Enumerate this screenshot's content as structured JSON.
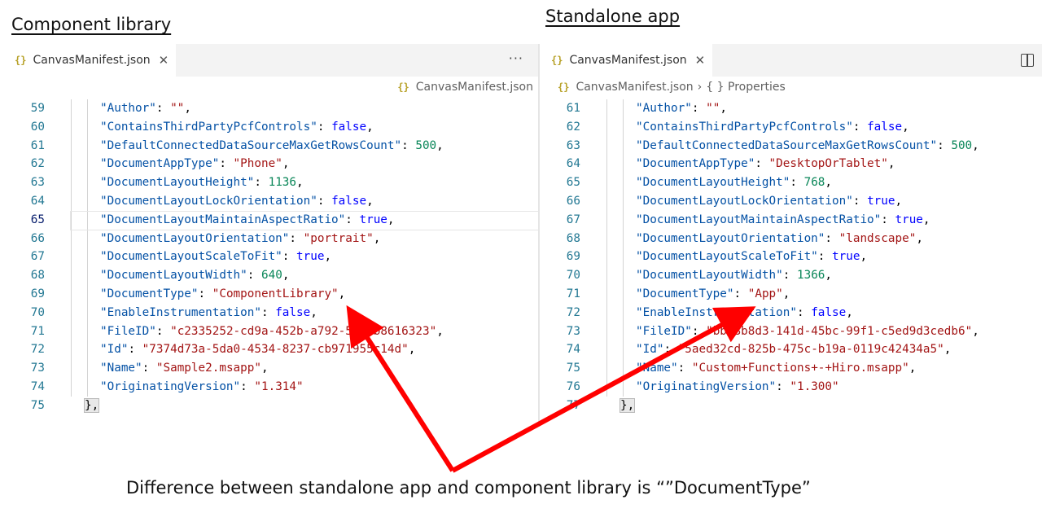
{
  "headings": {
    "left": "Component library",
    "right": "Standalone app"
  },
  "left_pane": {
    "tab": {
      "icon": "json-braces-icon",
      "label": "CanvasManifest.json"
    },
    "breadcrumb": [
      "CanvasManifest.json"
    ],
    "lines": [
      {
        "num": "59",
        "parts": [
          [
            "k",
            "\"Author\""
          ],
          [
            "p",
            ": "
          ],
          [
            "s",
            "\"\""
          ],
          [
            "p",
            ","
          ]
        ]
      },
      {
        "num": "60",
        "parts": [
          [
            "k",
            "\"ContainsThirdPartyPcfControls\""
          ],
          [
            "p",
            ": "
          ],
          [
            "b",
            "false"
          ],
          [
            "p",
            ","
          ]
        ]
      },
      {
        "num": "61",
        "parts": [
          [
            "k",
            "\"DefaultConnectedDataSourceMaxGetRowsCount\""
          ],
          [
            "p",
            ": "
          ],
          [
            "n",
            "500"
          ],
          [
            "p",
            ","
          ]
        ]
      },
      {
        "num": "62",
        "parts": [
          [
            "k",
            "\"DocumentAppType\""
          ],
          [
            "p",
            ": "
          ],
          [
            "s",
            "\"Phone\""
          ],
          [
            "p",
            ","
          ]
        ]
      },
      {
        "num": "63",
        "parts": [
          [
            "k",
            "\"DocumentLayoutHeight\""
          ],
          [
            "p",
            ": "
          ],
          [
            "n",
            "1136"
          ],
          [
            "p",
            ","
          ]
        ]
      },
      {
        "num": "64",
        "parts": [
          [
            "k",
            "\"DocumentLayoutLockOrientation\""
          ],
          [
            "p",
            ": "
          ],
          [
            "b",
            "false"
          ],
          [
            "p",
            ","
          ]
        ]
      },
      {
        "num": "65",
        "parts": [
          [
            "k",
            "\"DocumentLayoutMaintainAspectRatio\""
          ],
          [
            "p",
            ": "
          ],
          [
            "b",
            "true"
          ],
          [
            "p",
            ","
          ]
        ]
      },
      {
        "num": "66",
        "parts": [
          [
            "k",
            "\"DocumentLayoutOrientation\""
          ],
          [
            "p",
            ": "
          ],
          [
            "s",
            "\"portrait\""
          ],
          [
            "p",
            ","
          ]
        ]
      },
      {
        "num": "67",
        "parts": [
          [
            "k",
            "\"DocumentLayoutScaleToFit\""
          ],
          [
            "p",
            ": "
          ],
          [
            "b",
            "true"
          ],
          [
            "p",
            ","
          ]
        ]
      },
      {
        "num": "68",
        "parts": [
          [
            "k",
            "\"DocumentLayoutWidth\""
          ],
          [
            "p",
            ": "
          ],
          [
            "n",
            "640"
          ],
          [
            "p",
            ","
          ]
        ]
      },
      {
        "num": "69",
        "parts": [
          [
            "k",
            "\"DocumentType\""
          ],
          [
            "p",
            ": "
          ],
          [
            "s",
            "\"ComponentLibrary\""
          ],
          [
            "p",
            ","
          ]
        ]
      },
      {
        "num": "70",
        "parts": [
          [
            "k",
            "\"EnableInstrumentation\""
          ],
          [
            "p",
            ": "
          ],
          [
            "b",
            "false"
          ],
          [
            "p",
            ","
          ]
        ]
      },
      {
        "num": "71",
        "parts": [
          [
            "k",
            "\"FileID\""
          ],
          [
            "p",
            ": "
          ],
          [
            "s",
            "\"c2335252-cd9a-452b-a792-56d5b8616323\""
          ],
          [
            "p",
            ","
          ]
        ]
      },
      {
        "num": "72",
        "parts": [
          [
            "k",
            "\"Id\""
          ],
          [
            "p",
            ": "
          ],
          [
            "s",
            "\"7374d73a-5da0-4534-8237-cb971955c14d\""
          ],
          [
            "p",
            ","
          ]
        ]
      },
      {
        "num": "73",
        "parts": [
          [
            "k",
            "\"Name\""
          ],
          [
            "p",
            ": "
          ],
          [
            "s",
            "\"Sample2.msapp\""
          ],
          [
            "p",
            ","
          ]
        ]
      },
      {
        "num": "74",
        "parts": [
          [
            "k",
            "\"OriginatingVersion\""
          ],
          [
            "p",
            ": "
          ],
          [
            "s",
            "\"1.314\""
          ]
        ]
      },
      {
        "num": "75",
        "parts": [
          [
            "p",
            "},"
          ]
        ]
      }
    ]
  },
  "right_pane": {
    "tab": {
      "icon": "json-braces-icon",
      "label": "CanvasManifest.json"
    },
    "breadcrumb": [
      "CanvasManifest.json",
      "{ } Properties"
    ],
    "lines": [
      {
        "num": "61",
        "parts": [
          [
            "k",
            "\"Author\""
          ],
          [
            "p",
            ": "
          ],
          [
            "s",
            "\"\""
          ],
          [
            "p",
            ","
          ]
        ]
      },
      {
        "num": "62",
        "parts": [
          [
            "k",
            "\"ContainsThirdPartyPcfControls\""
          ],
          [
            "p",
            ": "
          ],
          [
            "b",
            "false"
          ],
          [
            "p",
            ","
          ]
        ]
      },
      {
        "num": "63",
        "parts": [
          [
            "k",
            "\"DefaultConnectedDataSourceMaxGetRowsCount\""
          ],
          [
            "p",
            ": "
          ],
          [
            "n",
            "500"
          ],
          [
            "p",
            ","
          ]
        ]
      },
      {
        "num": "64",
        "parts": [
          [
            "k",
            "\"DocumentAppType\""
          ],
          [
            "p",
            ": "
          ],
          [
            "s",
            "\"DesktopOrTablet\""
          ],
          [
            "p",
            ","
          ]
        ]
      },
      {
        "num": "65",
        "parts": [
          [
            "k",
            "\"DocumentLayoutHeight\""
          ],
          [
            "p",
            ": "
          ],
          [
            "n",
            "768"
          ],
          [
            "p",
            ","
          ]
        ]
      },
      {
        "num": "66",
        "parts": [
          [
            "k",
            "\"DocumentLayoutLockOrientation\""
          ],
          [
            "p",
            ": "
          ],
          [
            "b",
            "true"
          ],
          [
            "p",
            ","
          ]
        ]
      },
      {
        "num": "67",
        "parts": [
          [
            "k",
            "\"DocumentLayoutMaintainAspectRatio\""
          ],
          [
            "p",
            ": "
          ],
          [
            "b",
            "true"
          ],
          [
            "p",
            ","
          ]
        ]
      },
      {
        "num": "68",
        "parts": [
          [
            "k",
            "\"DocumentLayoutOrientation\""
          ],
          [
            "p",
            ": "
          ],
          [
            "s",
            "\"landscape\""
          ],
          [
            "p",
            ","
          ]
        ]
      },
      {
        "num": "69",
        "parts": [
          [
            "k",
            "\"DocumentLayoutScaleToFit\""
          ],
          [
            "p",
            ": "
          ],
          [
            "b",
            "true"
          ],
          [
            "p",
            ","
          ]
        ]
      },
      {
        "num": "70",
        "parts": [
          [
            "k",
            "\"DocumentLayoutWidth\""
          ],
          [
            "p",
            ": "
          ],
          [
            "n",
            "1366"
          ],
          [
            "p",
            ","
          ]
        ]
      },
      {
        "num": "71",
        "parts": [
          [
            "k",
            "\"DocumentType\""
          ],
          [
            "p",
            ": "
          ],
          [
            "s",
            "\"App\""
          ],
          [
            "p",
            ","
          ]
        ]
      },
      {
        "num": "72",
        "parts": [
          [
            "k",
            "\"EnableInstrumentation\""
          ],
          [
            "p",
            ": "
          ],
          [
            "b",
            "false"
          ],
          [
            "p",
            ","
          ]
        ]
      },
      {
        "num": "73",
        "parts": [
          [
            "k",
            "\"FileID\""
          ],
          [
            "p",
            ": "
          ],
          [
            "s",
            "\"bb58b8d3-141d-45bc-99f1-c5ed9d3cedb6\""
          ],
          [
            "p",
            ","
          ]
        ]
      },
      {
        "num": "74",
        "parts": [
          [
            "k",
            "\"Id\""
          ],
          [
            "p",
            ": "
          ],
          [
            "s",
            "\"5aed32cd-825b-475c-b19a-0119c42434a5\""
          ],
          [
            "p",
            ","
          ]
        ]
      },
      {
        "num": "75",
        "parts": [
          [
            "k",
            "\"Name\""
          ],
          [
            "p",
            ": "
          ],
          [
            "s",
            "\"Custom+Functions+-+Hiro.msapp\""
          ],
          [
            "p",
            ","
          ]
        ]
      },
      {
        "num": "76",
        "parts": [
          [
            "k",
            "\"OriginatingVersion\""
          ],
          [
            "p",
            ": "
          ],
          [
            "s",
            "\"1.300\""
          ]
        ]
      },
      {
        "num": "77",
        "parts": [
          [
            "p",
            "},"
          ]
        ]
      }
    ]
  },
  "caption": "Difference between standalone app and component library is “”DocumentType”",
  "colors": {
    "arrow": "#ff0000",
    "key": "#0451a5",
    "string": "#a31515",
    "number": "#098658",
    "boolean": "#0000ff"
  }
}
